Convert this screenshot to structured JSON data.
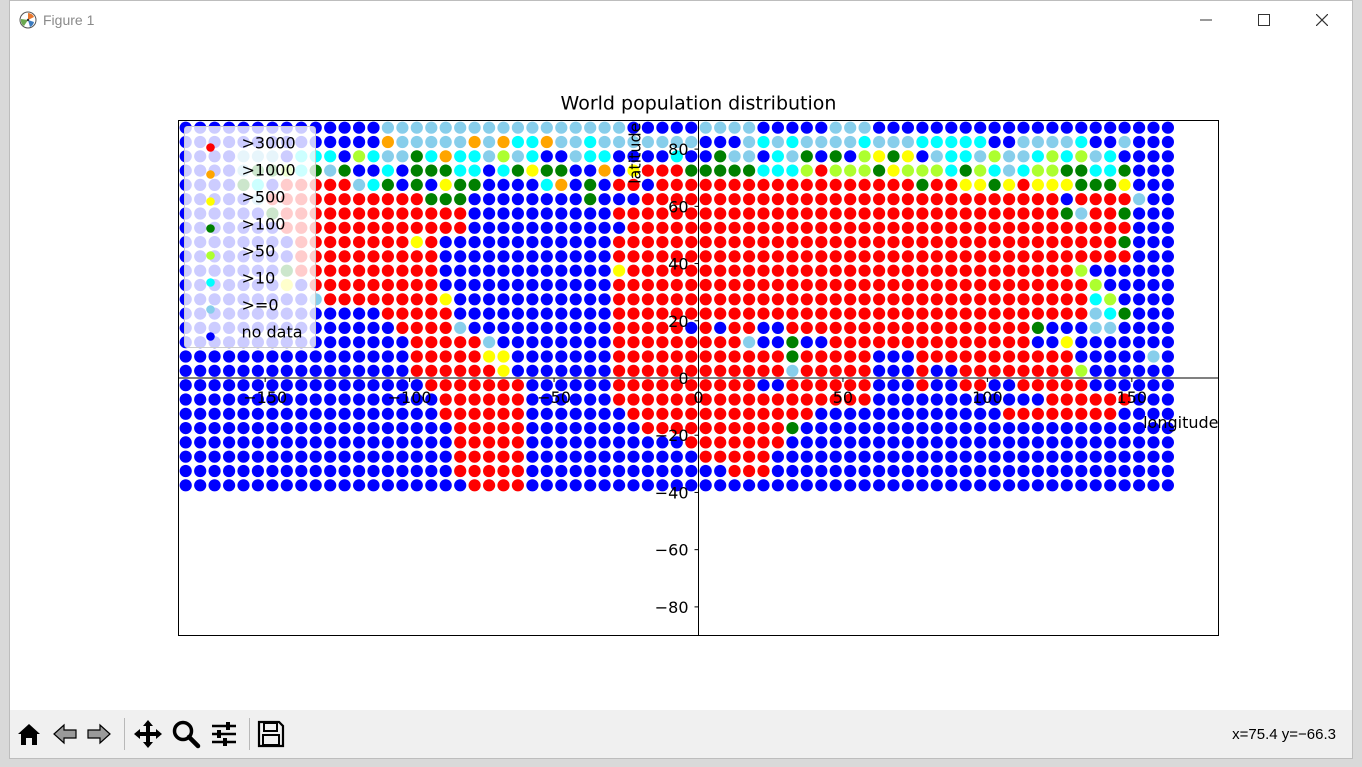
{
  "window": {
    "title": "Figure 1"
  },
  "status": {
    "coords": "x=75.4 y=−66.3"
  },
  "toolbar": {
    "buttons": [
      "home-icon",
      "back-icon",
      "forward-icon",
      "pan-icon",
      "zoom-icon",
      "configure-icon",
      "save-icon"
    ]
  },
  "chart_data": {
    "type": "scatter",
    "title": "World population distribution",
    "xlabel": "longitude",
    "ylabel": "latitude",
    "xlim": [
      -180,
      180
    ],
    "ylim": [
      -90,
      90
    ],
    "xticks": [
      -150,
      -100,
      -50,
      0,
      50,
      100,
      150
    ],
    "xtick_labels": [
      "−150",
      "−100",
      "−50",
      "0",
      "50",
      "100",
      "150"
    ],
    "yticks": [
      -80,
      -60,
      -40,
      -20,
      0,
      20,
      40,
      60,
      80
    ],
    "ytick_labels": [
      "−80",
      "−60",
      "−40",
      "−20",
      "0",
      "20",
      "40",
      "60",
      "80"
    ],
    "grid": false,
    "spines": "centered at origin",
    "legend_position": "top-left",
    "legend": [
      {
        "label": ">3000",
        "color": "#ff0000"
      },
      {
        "label": ">1000",
        "color": "#ffa500"
      },
      {
        "label": ">500",
        "color": "#ffff00"
      },
      {
        "label": ">100",
        "color": "#008000"
      },
      {
        "label": ">50",
        "color": "#adff2f"
      },
      {
        "label": ">10",
        "color": "#00ffff"
      },
      {
        "label": ">=0",
        "color": "#87ceeb"
      },
      {
        "label": "no data",
        "color": "#0000ff"
      }
    ],
    "grid_points": {
      "lon_start": -177.5,
      "lon_step": 5,
      "lat_start": 87.5,
      "lat_step": -5,
      "code_key": "0=>3000 1=>1000 2=>500 3=>100 4=>50 5=>10 6=>=0 7=no data",
      "rows": [
        "777777777777776666666666666666677777666677777666777777777777777777777",
        "777777777777771666661615516656666666777656566665666555557766665776777",
        "777766675557456635155646577655777757736675637374232765564665454657777",
        "777763345363775733355753233771720003333355540444324445345654433553777",
        "777735700000653737233777751737007000000000000000000300223202223332777",
        "777776000000000003337777777737770000000000000000000000000000070000677",
        "777777300000000000007777777777000000000000000000000000000000036003777",
        "777777700000000000007777777777700000000000000000000000000000000000777",
        "777777770000000020777777777777000000000000000000000000000000000003777",
        "777777770000000000777777777777000000000000000000000000000000000000777",
        "777777730000000000777777777777200000000000000000000000000000004777777",
        "777777727000000000777777777777000000000000000000000000000000000477777",
        "777777777600000000277777777777000000000000000000000000000000000547777",
        "777777777777770000077777777777000000000000000000000000000000000653777",
        "777777777777777000067777777777000007070077000000000000000003777667777",
        "777777777777777700000677777777000000000677377000000000000007727777777",
        "777777777777777700000227777777000000000000300000777000000000007777767",
        "777777777777777700000027777777000000000000600000777077000000004777777",
        "777777777777777770000000777777000000000077000000777077007700000777777",
        "777777777777777777000000777777000000000000000000777777777777000000777",
        "777777777777777777000000777777700000000000007777777777777000000007777",
        "777777777777777777700000777777770000000000377777777777777777777777777",
        "777777777777777777700000777777777770000000777777777777777777777777777",
        "777777777777777777700000777777777777000007777777777777777777777777777",
        "777777777777777777700000777777777777770007777777777777777777777777777",
        "777777777777777777770000777777777777777777777777777777777777777777777"
      ]
    }
  }
}
